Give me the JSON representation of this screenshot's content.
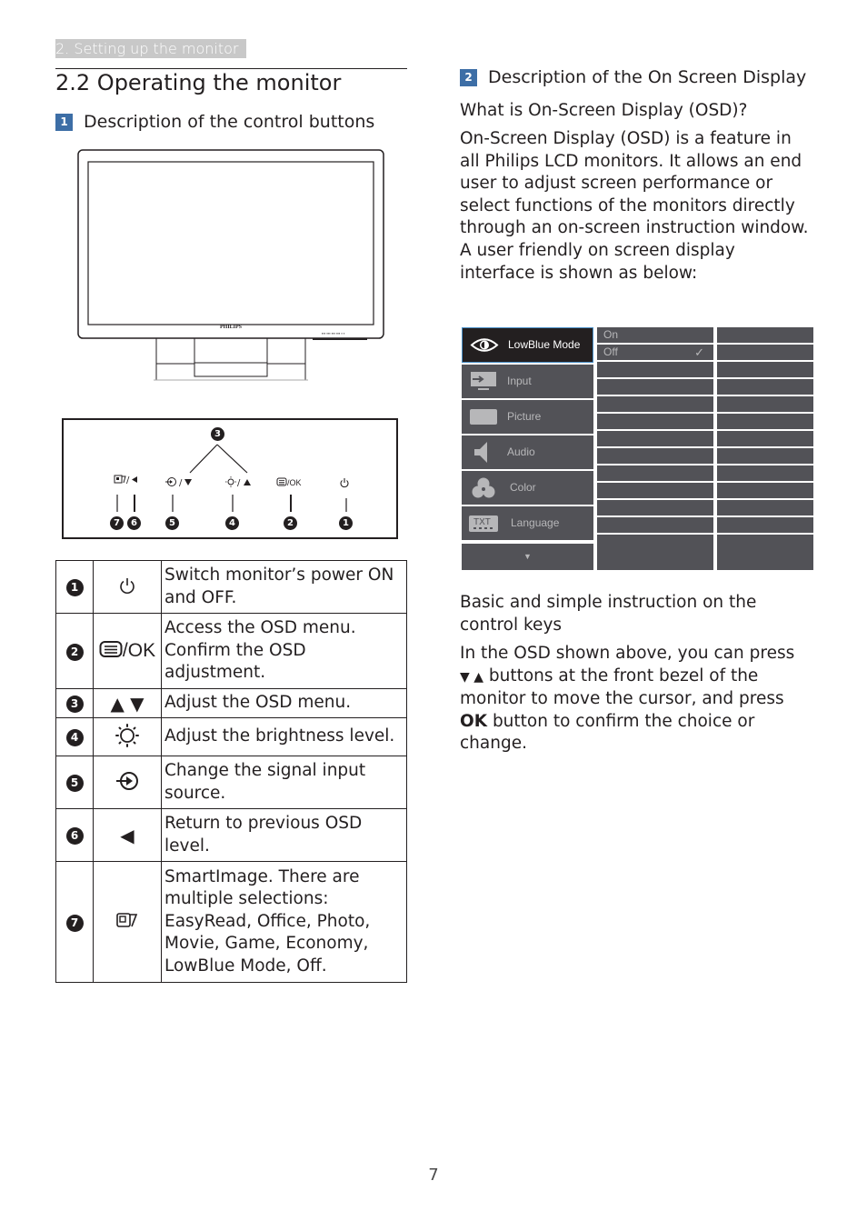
{
  "header": {
    "breadcrumb": "2. Setting up the monitor",
    "title": "2.2 Operating the monitor"
  },
  "section1": {
    "number": "1",
    "heading": "Description of the control buttons",
    "monitor_brand": "PHILIPS",
    "button_strip": {
      "callout_top": "3",
      "buttons": [
        {
          "symbol": "SmartImage/◄",
          "callouts": [
            "7",
            "6"
          ]
        },
        {
          "symbol": "Input/▼",
          "callouts": [
            "5"
          ]
        },
        {
          "symbol": "Brightness/▲",
          "callouts": [
            "4"
          ]
        },
        {
          "symbol": "Menu/OK",
          "callouts": [
            "2"
          ]
        },
        {
          "symbol": "Power",
          "callouts": [
            "1"
          ]
        }
      ],
      "ok_label": "/OK"
    },
    "table": [
      {
        "num": "1",
        "icon": "power-icon",
        "text": "Switch monitor’s power ON and OFF."
      },
      {
        "num": "2",
        "icon": "menu-ok-icon",
        "icon_text": "/OK",
        "text": "Access the OSD menu. Confirm the OSD adjustment."
      },
      {
        "num": "3",
        "icon": "up-down-arrows-icon",
        "icon_text": "▲ ▼",
        "text": "Adjust the OSD menu."
      },
      {
        "num": "4",
        "icon": "brightness-icon",
        "text": "Adjust the brightness level."
      },
      {
        "num": "5",
        "icon": "input-icon",
        "text": "Change the signal input source."
      },
      {
        "num": "6",
        "icon": "back-arrow-icon",
        "icon_text": "◀",
        "text": "Return to previous OSD level."
      },
      {
        "num": "7",
        "icon": "smartimage-icon",
        "text": "SmartImage. There are multiple selections: EasyRead, Office, Photo, Movie, Game, Economy, LowBlue Mode, Off."
      }
    ]
  },
  "section2": {
    "number": "2",
    "heading": "Description of the On Screen Display",
    "question": "What is On-Screen Display (OSD)?",
    "paragraph": "On-Screen Display (OSD) is a feature in all Philips LCD monitors. It allows an end user to adjust screen performance or select functions of the monitors directly through an on-screen instruction window. A user friendly on screen display interface is shown as below:",
    "osd": {
      "menu": [
        {
          "label": "LowBlue Mode",
          "icon": "eye-icon",
          "selected": true
        },
        {
          "label": "Input",
          "icon": "input-monitor-icon"
        },
        {
          "label": "Picture",
          "icon": "picture-icon"
        },
        {
          "label": "Audio",
          "icon": "speaker-icon"
        },
        {
          "label": "Color",
          "icon": "color-icon"
        },
        {
          "label": "Language",
          "icon": "txt-icon",
          "icon_text": "TXT"
        }
      ],
      "more_indicator": "▼",
      "submenu": [
        {
          "label": "On",
          "checked": false
        },
        {
          "label": "Off",
          "checked": true
        }
      ],
      "check_mark": "✓"
    },
    "instruction_heading": "Basic and simple instruction on the control keys",
    "instruction": {
      "pre": "In the OSD shown above, you can press",
      "arrows": "▼ ▲",
      "mid": " buttons at the front bezel of the monitor to move the cursor, and press ",
      "ok": "OK",
      "post": " button to confirm the choice or change."
    }
  },
  "footer": {
    "page_number": "7"
  },
  "colors": {
    "badge_blue": "#3d6ea6",
    "osd_gray": "#525257",
    "osd_selected": "#231f20",
    "osd_highlight_border": "#4a90c8",
    "breadcrumb_bg": "#c8c8c8"
  }
}
